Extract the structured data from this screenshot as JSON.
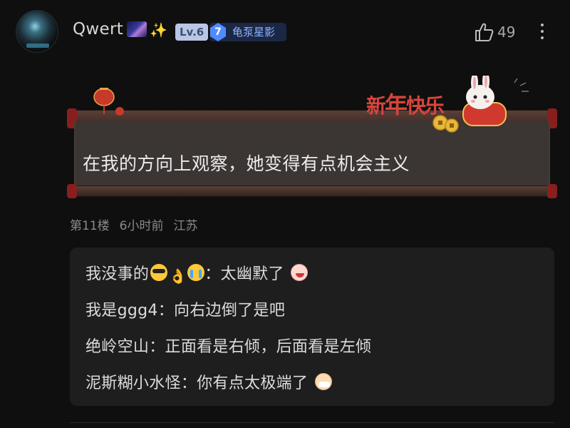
{
  "user": {
    "name": "Qwert",
    "emoji_icons": [
      "galaxy-icon",
      "sparkle-icon"
    ],
    "level": "Lv.6",
    "fan_badge": {
      "level": "7",
      "name": "龟泵星影"
    }
  },
  "actions": {
    "like_count": "49"
  },
  "decoration": {
    "new_year_text_small": "新",
    "new_year_text_big": "年",
    "new_year_text_rest": "快乐"
  },
  "comment": {
    "text": "在我的方向上观察，她变得有点机会主义",
    "floor": "第11楼",
    "time": "6小时前",
    "location": "江苏"
  },
  "replies": [
    {
      "name": "我没事的",
      "emojis": [
        "cool-face-icon",
        "ok-hand-icon",
        "crying-face-icon"
      ],
      "sep": "：",
      "text": "太幽默了",
      "trailing_emoji": "grinning-face-icon"
    },
    {
      "name": "我是ggg4",
      "sep": "：",
      "text": "向右边倒了是吧"
    },
    {
      "name": "绝岭空山",
      "sep": "：",
      "text": "正面看是右倾，后面看是左倾"
    },
    {
      "name": "泥斯糊小水怪",
      "sep": "：",
      "text": "你有点太极端了",
      "trailing_emoji": "mask-face-icon"
    }
  ],
  "colors": {
    "background": "#0f0f0f",
    "reply_panel": "#1e1e1e",
    "level_badge": "#b9c6e4",
    "fan_badge_bg": "#1b2845",
    "fan_badge_accent": "#4f8bff",
    "new_year_red": "#d8453c"
  }
}
